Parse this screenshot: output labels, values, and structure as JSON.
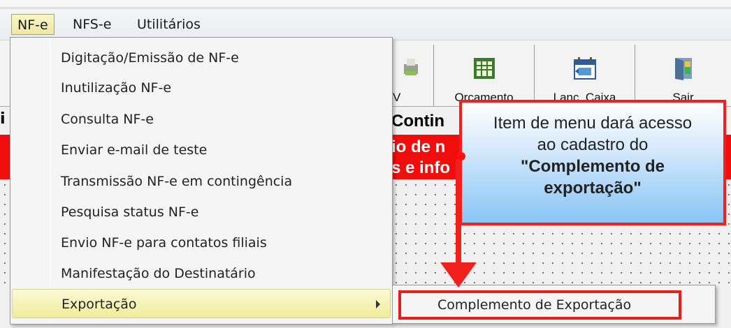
{
  "menubar": {
    "items": [
      {
        "label": "NF-e"
      },
      {
        "label": "NFS-e"
      },
      {
        "label": "Utilitários"
      }
    ]
  },
  "toolbar": {
    "buttons": [
      {
        "label": "V",
        "icon": "printer-icon"
      },
      {
        "label": "Orcamento",
        "icon": "spreadsheet-icon"
      },
      {
        "label": "Lanc. Caixa",
        "icon": "calendar-cash-icon"
      },
      {
        "label": "Sair",
        "icon": "exit-door-icon"
      }
    ]
  },
  "background": {
    "heading": "Contin",
    "banner_line1": "io de n",
    "banner_line2": "s e info"
  },
  "dropdown": {
    "items": [
      {
        "label": "Digitação/Emissão de NF-e"
      },
      {
        "label": "Inutilização NF-e"
      },
      {
        "label": "Consulta NF-e"
      },
      {
        "label": "Enviar e-mail de teste"
      },
      {
        "label": "Transmissão NF-e em contingência"
      },
      {
        "label": "Pesquisa status NF-e"
      },
      {
        "label": "Envio NF-e para contatos filiais"
      },
      {
        "label": "Manifestação do Destinatário"
      },
      {
        "label": "Exportação",
        "has_submenu": true,
        "highlighted": true
      }
    ]
  },
  "submenu": {
    "items": [
      {
        "label": "Complemento de Exportação"
      }
    ]
  },
  "callout": {
    "line1": "Item de menu dará acesso",
    "line2": "ao cadastro do",
    "line3": "\"Complemento de",
    "line4": "exportação\"",
    "border_color": "#f21f1f"
  },
  "colors": {
    "highlight": "#f1ec9a",
    "banner_red": "#f20d0d",
    "annotation_red": "#f21f1f"
  }
}
